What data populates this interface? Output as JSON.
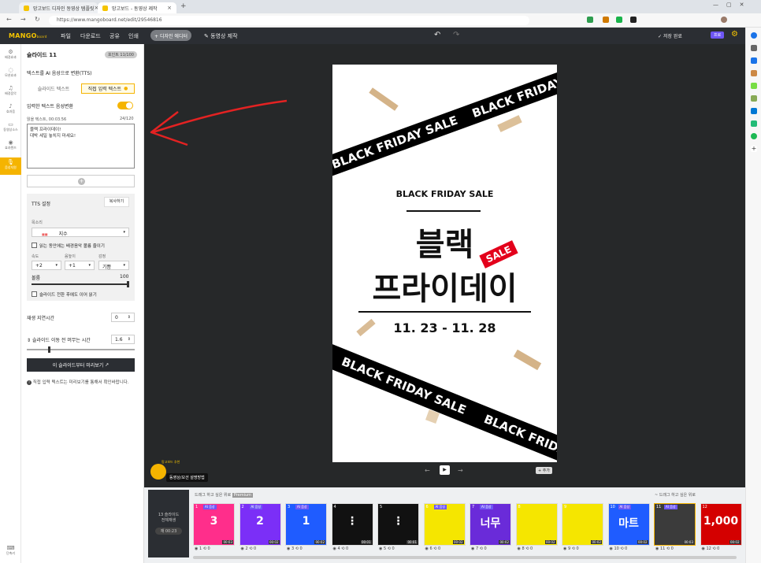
{
  "browser": {
    "tabs": [
      {
        "label": "망고보드 디자인 동영상 템플릿"
      },
      {
        "label": "망고보드 - 동영상 제작"
      }
    ],
    "url": "https://www.mangoboard.net/edit/29546816"
  },
  "appbar": {
    "logo": "MANGO",
    "logo_sub": "board",
    "menus": [
      "파일",
      "다운로드",
      "공유",
      "인쇄"
    ],
    "design_editor": "+ 디자인 에디터",
    "video_make": "동영상 제작",
    "save_status": "저장 완료",
    "premium": "프로"
  },
  "rail": {
    "items": [
      "배경효과",
      "모션효과",
      "배경음악",
      "효과음",
      "동영상소스",
      "효과렌즈",
      "음성지원"
    ],
    "bottom": "단축키"
  },
  "panel": {
    "title": "슬라이드 11",
    "credit": "포인트 11/100",
    "tts_heading": "텍스트를 AI 음성으로 변환(TTS)",
    "tab_slide_text": "슬라이드 텍스트",
    "tab_direct_text": "직접 입력 텍스트",
    "toggle_label": "입력한 텍스트 음성변환",
    "read_time_label": "읽을 텍스트, 00:03.56",
    "char_count": "24/120",
    "textarea_line1": "블랙 프라이데이!",
    "textarea_line2": "대박 세일 놓치지 마세요!",
    "tts_settings": "TTS 설정",
    "copy_btn": "복사하기",
    "voice_label": "목소리",
    "voice_value": "지수",
    "bgm_lower": "읽는 동안에는 배경음악 볼륨 줄이기",
    "speed_label": "속도",
    "speed_value": "+2",
    "pitch_label": "음높이",
    "pitch_value": "+1",
    "emotion_label": "감정",
    "emotion_value": "기쁨",
    "volume_label": "볼륨",
    "volume_value": "100",
    "volume_level": 1.0,
    "continue_label": "슬라이드 전환 후에도 이어 읽기",
    "delay_label": "재생 지연시간",
    "delay_value": "0",
    "wait_label": "슬라이드 이동 전 머무는 시간",
    "wait_value": "1.6",
    "wait_level": 0.2,
    "preview_btn": "이 슬라이드부터 미리보기",
    "note": "직접 입력 텍스트는 미리보기를 통해서 확인바랍니다."
  },
  "poster": {
    "band_top": "BLACK FRIDAY",
    "band_top_sale": "SALE",
    "headline": "BLACK FRIDAY SALE",
    "title_line1": "블랙",
    "title_line2": "프라이데이",
    "sale_tag": "SALE",
    "dates": "11. 23 - 11. 28",
    "band_bottom": "BLACK FRIDAY",
    "band_bottom_sale": "SALE"
  },
  "canvas_controls": {
    "add": "추가"
  },
  "mascot": {
    "caption": "망고보드 추천",
    "bubble": "동영상/모션 설명방법"
  },
  "timeline": {
    "drag_hint_left": "드래그 하고 싶은 위로",
    "drag_hint_badge": "Premium",
    "drag_hint_right": "~ 드래그 하고 싶은 위로",
    "counter_line1": "13 슬라이드",
    "counter_line2": "전체재생",
    "counter_time": "재 00:23",
    "slides": [
      {
        "num": "1",
        "badge": "AI 음성",
        "big": "3",
        "color": "#ff2e8b",
        "dur": "00:03"
      },
      {
        "num": "2",
        "badge": "AI 음성",
        "big": "2",
        "color": "#7b2ff7",
        "dur": "00:02"
      },
      {
        "num": "3",
        "badge": "AI 음성",
        "big": "1",
        "color": "#1f5cff",
        "dur": "00:02"
      },
      {
        "num": "4",
        "badge": "",
        "big": "⋮",
        "color": "#111111",
        "dur": "00:01"
      },
      {
        "num": "5",
        "badge": "",
        "big": "⋮",
        "color": "#111111",
        "dur": "00:01"
      },
      {
        "num": "6",
        "badge": "AI 음성",
        "big": "",
        "color": "#f5e600",
        "dur": "00:02"
      },
      {
        "num": "7",
        "badge": "AI 음성",
        "big": "너무",
        "color": "#6a2bd9",
        "dur": "00:02"
      },
      {
        "num": "8",
        "badge": "",
        "big": "",
        "color": "#f5e600",
        "dur": "00:02"
      },
      {
        "num": "9",
        "badge": "",
        "big": "",
        "color": "#f5e600",
        "dur": "00:02"
      },
      {
        "num": "10",
        "badge": "AI 음성",
        "big": "마트",
        "color": "#1f5cff",
        "dur": "00:02"
      },
      {
        "num": "11",
        "badge": "AI 음성",
        "big": "",
        "color": "#3b3b3b",
        "dur": "00:03"
      },
      {
        "num": "12",
        "badge": "",
        "big": "1,000",
        "color": "#d40000",
        "dur": "00:02"
      }
    ]
  }
}
